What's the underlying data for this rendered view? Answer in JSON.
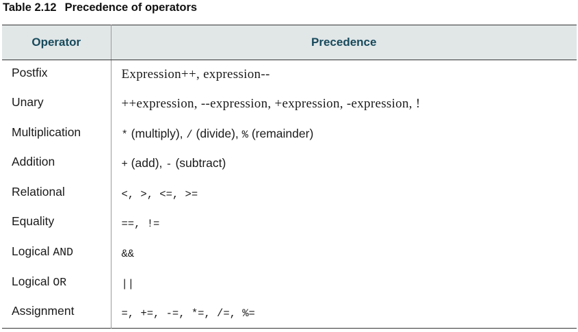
{
  "caption": {
    "number": "Table 2.12",
    "title": "Precedence of operators"
  },
  "table": {
    "headers": {
      "operator": "Operator",
      "precedence": "Precedence"
    },
    "rows": [
      {
        "name": "Postfix",
        "precedence": "Expression++, expression--"
      },
      {
        "name": "Unary",
        "precedence": "++expression, --expression, +expression, -expression, !"
      },
      {
        "name": "Multiplication",
        "precedence_parts": [
          "*",
          " (multiply), ",
          "/",
          " (divide), ",
          "%",
          " (remainder)"
        ]
      },
      {
        "name": "Addition",
        "precedence_parts": [
          "+",
          " (add), ",
          "-",
          " (subtract)"
        ]
      },
      {
        "name": "Relational",
        "precedence": "<, >, <=, >="
      },
      {
        "name": "Equality",
        "precedence": "==, !="
      },
      {
        "name_parts": [
          "Logical ",
          "AND"
        ],
        "precedence": "&&"
      },
      {
        "name_parts": [
          "Logical ",
          "OR"
        ],
        "precedence": "||"
      },
      {
        "name": "Assignment",
        "precedence": "=, +=, -=, *=, /=, %="
      }
    ]
  }
}
